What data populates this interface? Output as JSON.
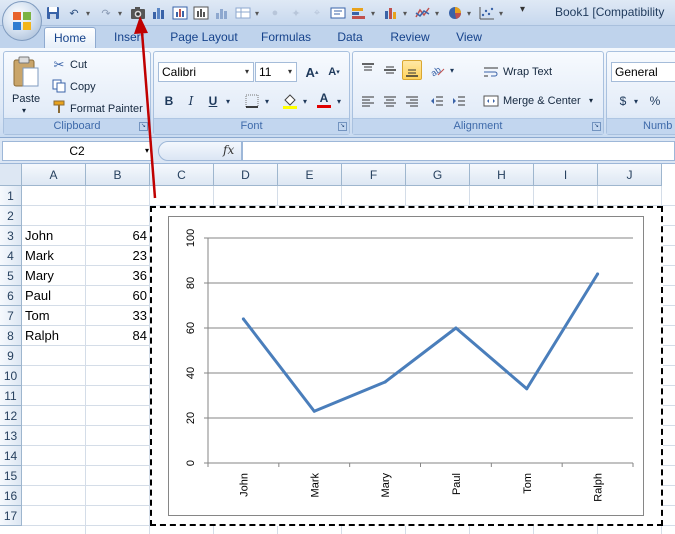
{
  "window": {
    "title": "Book1  [Compatibility"
  },
  "tabs": [
    {
      "label": "Home",
      "active": true
    },
    {
      "label": "Insert",
      "active": false
    },
    {
      "label": "Page Layout",
      "active": false
    },
    {
      "label": "Formulas",
      "active": false
    },
    {
      "label": "Data",
      "active": false
    },
    {
      "label": "Review",
      "active": false
    },
    {
      "label": "View",
      "active": false
    }
  ],
  "ribbon": {
    "clipboard": {
      "label": "Clipboard",
      "paste": "Paste",
      "cut": "Cut",
      "copy": "Copy",
      "format_painter": "Format Painter"
    },
    "font": {
      "label": "Font",
      "name": "Calibri",
      "size": "11",
      "bold": "B",
      "italic": "I",
      "underline": "U",
      "grow": "A",
      "shrink": "A",
      "color_letter": "A"
    },
    "alignment": {
      "label": "Alignment",
      "wrap_text": "Wrap Text",
      "merge_center": "Merge & Center"
    },
    "number": {
      "label": "Numb",
      "format": "General",
      "currency": "$",
      "percent": "%"
    }
  },
  "formula_bar": {
    "name_box": "C2",
    "fx": "fx",
    "value": ""
  },
  "columns": [
    "A",
    "B",
    "C",
    "D",
    "E",
    "F",
    "G",
    "H",
    "I",
    "J"
  ],
  "rows": [
    "1",
    "2",
    "3",
    "4",
    "5",
    "6",
    "7",
    "8",
    "9",
    "10",
    "11",
    "12",
    "13",
    "14",
    "15",
    "16",
    "17"
  ],
  "cells": [
    {
      "name": "John",
      "value": "64"
    },
    {
      "name": "Mark",
      "value": "23"
    },
    {
      "name": "Mary",
      "value": "36"
    },
    {
      "name": "Paul",
      "value": "60"
    },
    {
      "name": "Tom",
      "value": "33"
    },
    {
      "name": "Ralph",
      "value": "84"
    }
  ],
  "colors": {
    "series": "#4a7ebb",
    "gridline": "#868686",
    "arrow": "#c00000",
    "ribbon_text": "#15428b"
  },
  "chart_data": {
    "type": "line",
    "categories": [
      "John",
      "Mark",
      "Mary",
      "Paul",
      "Tom",
      "Ralph"
    ],
    "series": [
      {
        "values": [
          64,
          23,
          36,
          60,
          33,
          84
        ]
      }
    ],
    "yticks": [
      "0",
      "20",
      "40",
      "60",
      "80",
      "100"
    ],
    "ylim": [
      0,
      100
    ],
    "grid": true,
    "legend": "none",
    "title": "",
    "xlabel": "",
    "ylabel": ""
  }
}
